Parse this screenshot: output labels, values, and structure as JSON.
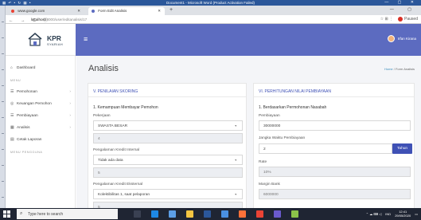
{
  "word": {
    "quick_access": "▦ ↶ • ↻ ▦ •",
    "title": "Document1 - Microsoft Word (Product Activation Failed)",
    "controls": "— ▢ ✕"
  },
  "browser": {
    "tabs": [
      {
        "label": "www.google.com",
        "favicon_color": "#ea4335"
      },
      {
        "label": "Form Edit Analisis",
        "favicon_color": "#5c6bc0"
      }
    ],
    "url_host": "localhost",
    "url_path": ":8000/user/editanalisis/17",
    "nav": "← → C ⓘ",
    "right": "☆ ⊞ ⋮",
    "profile": "Paused",
    "window_controls": "— ▢"
  },
  "app": {
    "logo_title": "KPR",
    "logo_sub": "SYARIAH",
    "user_name": "Irfan Kirana",
    "menu_icon": "≡"
  },
  "sidebar": {
    "items": [
      {
        "label": "Dashboard",
        "icon": "⌂",
        "chevron": ""
      },
      {
        "label": "Pemohonan",
        "icon": "☰",
        "chevron": "›"
      },
      {
        "label": "Keuangan Pemohon",
        "icon": "◎",
        "chevron": "›"
      },
      {
        "label": "Pembiayaan",
        "icon": "☰",
        "chevron": "›"
      },
      {
        "label": "Analisis",
        "icon": "▦",
        "chevron": "›"
      },
      {
        "label": "Cetak Laporan",
        "icon": "▤",
        "chevron": ""
      }
    ],
    "menu_head": "MENU",
    "user_head": "MENU PENGGUNA"
  },
  "page": {
    "title": "Analisis",
    "crumb_home": "Home",
    "crumb_current": "Form Analisis"
  },
  "left_card": {
    "title": "V. PENILAIAN SKORING",
    "section": "1. Kemampuan Membayar Pemohon",
    "pekerjaan_label": "Pekerjaan",
    "pekerjaan_value": "SWASTA BESAR",
    "pekerjaan_score": "4",
    "internal_label": "Pengalaman Kredit Internal",
    "internal_value": "Tidak ada data",
    "internal_score": "5",
    "eksternal_label": "Pengalaman Kredit Eksternal",
    "eksternal_value": "Kolektibilitas 1, saat pelaporan",
    "eksternal_score": "5",
    "caret": "▼"
  },
  "right_card": {
    "title": "VI. PERHITUNGAN NILAI PEMBIAYAAN",
    "section": "1. Berdasarkan Permohonan Nasabah",
    "pembiayaan_label": "Pembiayaan",
    "pembiayaan_value": "30000000",
    "jangka_label": "Jangka Waktu Pembiayaan",
    "jangka_value": "2",
    "jangka_button": "Tahun",
    "rate_label": "Rate",
    "rate_value": "10%",
    "margin_label": "Margin Bank",
    "margin_value": "6000000"
  },
  "taskbar": {
    "search_placeholder": "Type here to search",
    "tray_icons": "⌃ ☁ ⌨ ◁",
    "lang": "IND",
    "time": "12:41",
    "date": "29/05/2020"
  },
  "colors": {
    "topbar": "#5c6bc0",
    "accent": "#3f51b5",
    "word_blue": "#2b579a"
  }
}
